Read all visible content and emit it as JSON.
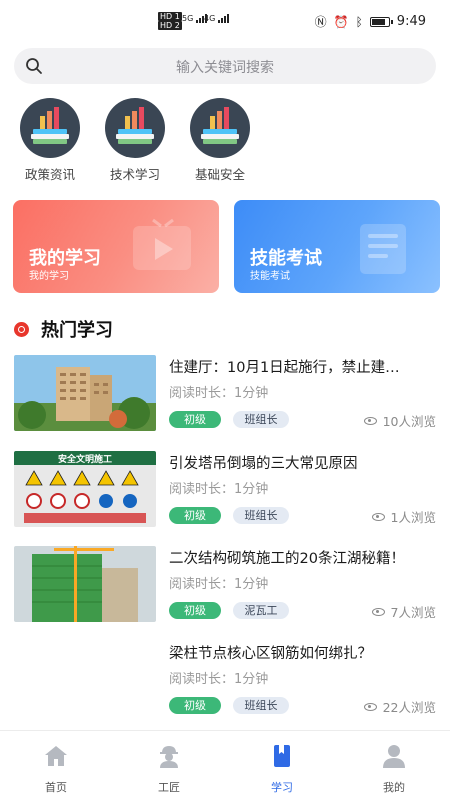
{
  "status_bar": {
    "sim1": "HD 1",
    "sim2": "HD 2",
    "net1": "5G",
    "net2": "4G",
    "time": "9:49"
  },
  "search": {
    "placeholder": "输入关键词搜索"
  },
  "categories": [
    {
      "label": "政策资讯",
      "icon": "books-chart-icon"
    },
    {
      "label": "技术学习",
      "icon": "books-chart-icon"
    },
    {
      "label": "基础安全",
      "icon": "books-chart-icon"
    }
  ],
  "cards": [
    {
      "title": "我的学习",
      "subtitle": "我的学习",
      "color": "#fb6f63",
      "icon": "play-tv-icon"
    },
    {
      "title": "技能考试",
      "subtitle": "技能考试",
      "color": "#3d8cf7",
      "icon": "document-icon"
    }
  ],
  "hot": {
    "title": "热门学习",
    "items": [
      {
        "title": "住建厅：10月1日起施行，禁止建…",
        "read": "阅读时长：1分钟",
        "level": "初级",
        "role": "班组长",
        "views": "10人浏览",
        "thumb": "building-photo"
      },
      {
        "title": "引发塔吊倒塌的三大常见原因",
        "read": "阅读时长：1分钟",
        "level": "初级",
        "role": "班组长",
        "views": "1人浏览",
        "thumb": "safety-sign-photo",
        "thumb_text": "安全文明施工"
      },
      {
        "title": "二次结构砌筑施工的20条江湖秘籍！",
        "read": "阅读时长：1分钟",
        "level": "初级",
        "role": "泥瓦工",
        "views": "7人浏览",
        "thumb": "construction-photo"
      },
      {
        "title": "梁柱节点核心区钢筋如何绑扎？",
        "read": "阅读时长：1分钟",
        "level": "初级",
        "role": "班组长",
        "views": "22人浏览",
        "thumb": ""
      }
    ]
  },
  "tabbar": [
    {
      "label": "首页",
      "icon": "home-icon",
      "active": false
    },
    {
      "label": "工匠",
      "icon": "worker-icon",
      "active": false
    },
    {
      "label": "学习",
      "icon": "book-icon",
      "active": true
    },
    {
      "label": "我的",
      "icon": "user-icon",
      "active": false
    }
  ],
  "colors": {
    "accent": "#2f6ae5",
    "tag_green": "#3cb878",
    "hot_red": "#e8362c"
  }
}
